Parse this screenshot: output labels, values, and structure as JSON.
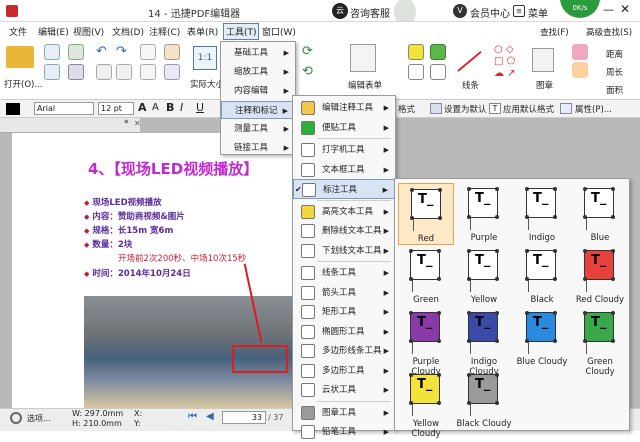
{
  "titlebar": {
    "title": "14 - 迅捷PDF编辑器",
    "consult": "咨询客服",
    "member": "会员中心",
    "menu": "菜单",
    "speed": "0K/s",
    "cloud_tag": "云",
    "v_badge": "V",
    "min": "—",
    "close": "✕"
  },
  "menubar": [
    "文件",
    "编辑(E)",
    "视图(V)",
    "文档(D)",
    "注释(C)",
    "表单(R)",
    "工具(T)",
    "窗口(W)"
  ],
  "ribbon": {
    "open": "打开(O)...",
    "actual": "实际大小",
    "edit_form": "编辑表单",
    "line": "线条",
    "stamp": "图章",
    "find": "查找(F)",
    "adv_find": "高级查找(S)",
    "distance": "距离",
    "perimeter": "周长",
    "area": "面积",
    "one_to_one": "1:1"
  },
  "formatbar": {
    "font": "Arial",
    "size": "12 pt",
    "format": "格式",
    "set_default": "设置为默认",
    "apply_default": "应用默认格式",
    "properties": "属性(P)..."
  },
  "tab": {
    "label": "*"
  },
  "document": {
    "heading": "4、【现场LED视频播放】",
    "items": [
      "现场LED视频播放",
      "内容：赞助商视频&图片",
      "规格：长15m 宽6m",
      "数量：2块"
    ],
    "note": "开场前2次200秒、中场10次15秒",
    "time": "时间：2014年10月24日"
  },
  "statusbar": {
    "options": "选项...",
    "w": "W: 297.0mm",
    "h": "H: 210.0mm",
    "x": "X:",
    "y": "Y:",
    "page": "33",
    "total": "/ 37"
  },
  "tool_menu": [
    {
      "label": "基础工具"
    },
    {
      "label": "缩放工具"
    },
    {
      "label": "内容编辑"
    },
    {
      "label": "注释和标记",
      "highlighted": true
    },
    {
      "label": "测量工具"
    },
    {
      "label": "链接工具"
    }
  ],
  "markup_menu": [
    {
      "label": "编辑注释工具",
      "icon": "edit-annotation-icon",
      "color": "#f3c74a"
    },
    {
      "label": "便贴工具",
      "icon": "sticky-note-icon",
      "color": "#2fae3a"
    },
    {
      "label": "打字机工具",
      "icon": "typewriter-icon",
      "color": "#ffffff"
    },
    {
      "label": "文本框工具",
      "icon": "textbox-icon",
      "color": "#ffffff"
    },
    {
      "label": "标注工具",
      "icon": "callout-icon",
      "color": "#ffffff",
      "checked": true,
      "highlighted": true
    },
    {
      "label": "高亮文本工具",
      "icon": "highlight-text-icon",
      "color": "#f3d63a"
    },
    {
      "label": "删除线文本工具",
      "icon": "strikeout-text-icon",
      "color": "#ffffff"
    },
    {
      "label": "下划线文本工具",
      "icon": "underline-text-icon",
      "color": "#ffffff"
    },
    {
      "label": "线条工具",
      "icon": "line-icon",
      "color": "#ffffff"
    },
    {
      "label": "箭头工具",
      "icon": "arrow-icon",
      "color": "#ffffff"
    },
    {
      "label": "矩形工具",
      "icon": "rectangle-icon",
      "color": "#ffffff"
    },
    {
      "label": "椭圆形工具",
      "icon": "ellipse-icon",
      "color": "#ffffff"
    },
    {
      "label": "多边形线条工具",
      "icon": "polyline-icon",
      "color": "#ffffff"
    },
    {
      "label": "多边形工具",
      "icon": "polygon-icon",
      "color": "#ffffff"
    },
    {
      "label": "云状工具",
      "icon": "cloud-icon",
      "color": "#ffffff"
    },
    {
      "label": "图章工具",
      "icon": "stamp-icon",
      "color": "#9a9a9a"
    },
    {
      "label": "铅笔工具",
      "icon": "pencil-icon",
      "color": "#ffffff"
    }
  ],
  "gallery": [
    {
      "label": "Red",
      "color": "#ffffff",
      "selected": true
    },
    {
      "label": "Purple",
      "color": "#ffffff"
    },
    {
      "label": "Indigo",
      "color": "#ffffff"
    },
    {
      "label": "Blue",
      "color": "#ffffff"
    },
    {
      "label": "Green",
      "color": "#ffffff"
    },
    {
      "label": "Yellow",
      "color": "#ffffff"
    },
    {
      "label": "Black",
      "color": "#ffffff"
    },
    {
      "label": "Red Cloudy",
      "color": "#e8403a"
    },
    {
      "label": "Purple Cloudy",
      "color": "#8a3aa8"
    },
    {
      "label": "Indigo Cloudy",
      "color": "#3a4aa8"
    },
    {
      "label": "Blue Cloudy",
      "color": "#2a8ae0"
    },
    {
      "label": "Green Cloudy",
      "color": "#3aa84a"
    },
    {
      "label": "Yellow Cloudy",
      "color": "#f3e23a"
    },
    {
      "label": "Black Cloudy",
      "color": "#9a9a9a"
    }
  ],
  "gallery_glyph": "T_"
}
